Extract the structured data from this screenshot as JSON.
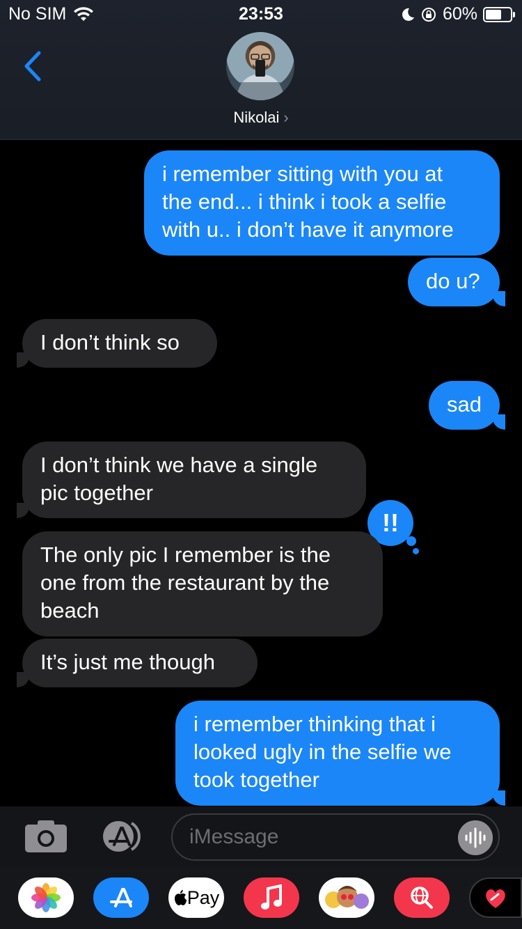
{
  "status_bar": {
    "carrier": "No SIM",
    "time": "23:53",
    "battery": "60%",
    "battery_level": 0.6
  },
  "contact": {
    "name": "Nikolai",
    "chevron": "›"
  },
  "messages": [
    {
      "side": "sent",
      "text": "i remember sitting with you at\nthe end... i think i took a selfie\nwith u.. i don’t have it anymore"
    },
    {
      "side": "sent",
      "text": "do u?"
    },
    {
      "side": "received",
      "text": "I don’t think so"
    },
    {
      "side": "sent",
      "text": "sad"
    },
    {
      "side": "received",
      "text": "I don’t think we have a single\npic together"
    },
    {
      "side": "received",
      "text": "The only pic I remember is the\none from the restaurant by the\nbeach"
    },
    {
      "side": "received",
      "text": "It’s just me though"
    },
    {
      "side": "sent",
      "text": "i remember thinking that i\nlooked ugly in the selfie we\ntook together"
    }
  ],
  "reaction": {
    "symbol": "!!",
    "icon": "exclamation-tapback-icon"
  },
  "compose": {
    "placeholder": "iMessage",
    "icons": [
      "camera-icon",
      "app-store-icon",
      "audio-message-icon"
    ]
  },
  "app_drawer": {
    "apple_pay_label": "Pay",
    "apps": [
      "photos-icon",
      "app-store-icon",
      "apple-pay-icon",
      "music-icon",
      "memoji-icon",
      "web-search-icon",
      "digital-touch-icon"
    ]
  },
  "colors": {
    "sent_bubble": "#1b86f8",
    "received_bubble": "#262628",
    "accent": "#1b86f8"
  }
}
